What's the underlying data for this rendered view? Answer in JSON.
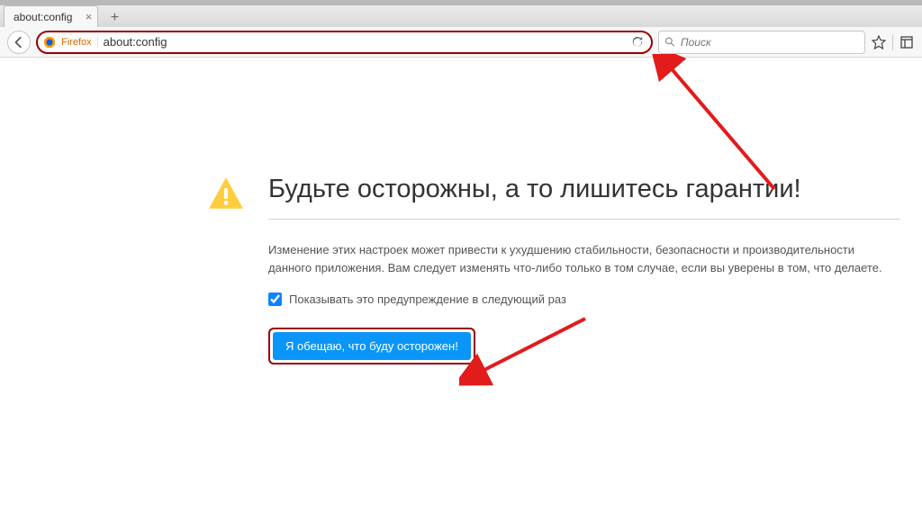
{
  "tab": {
    "title": "about:config"
  },
  "toolbar": {
    "brand": "Firefox",
    "url": "about:config",
    "search_placeholder": "Поиск"
  },
  "warning": {
    "heading": "Будьте осторожны, а то лишитесь гарантии!",
    "body": "Изменение этих настроек может привести к ухудшению стабильности, безопасности и производительности данного приложения. Вам следует изменять что-либо только в том случае, если вы уверены в том, что делаете.",
    "checkbox_label": "Показывать это предупреждение в следующий раз",
    "button_label": "Я обещаю, что буду осторожен!"
  }
}
